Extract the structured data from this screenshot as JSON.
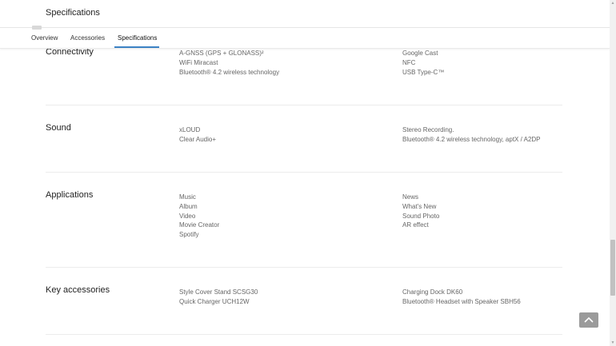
{
  "header": {
    "title": "Specifications"
  },
  "tabs": [
    {
      "label": "Overview"
    },
    {
      "label": "Accessories"
    },
    {
      "label": "Specifications",
      "active": true
    }
  ],
  "sections": [
    {
      "title": "Connectivity",
      "left": [
        "A-GNSS (GPS + GLONASS)²",
        "WiFi Miracast",
        "Bluetooth® 4.2 wireless technology"
      ],
      "right": [
        "Google Cast",
        "NFC",
        "USB Type-C™"
      ]
    },
    {
      "title": "Sound",
      "left": [
        "xLOUD",
        "Clear Audio+"
      ],
      "right": [
        "Stereo Recording.",
        "Bluetooth® 4.2 wireless technology, aptX / A2DP"
      ]
    },
    {
      "title": "Applications",
      "left": [
        "Music",
        "Album",
        "Video",
        "Movie Creator",
        "Spotify"
      ],
      "right": [
        "News",
        "What's New",
        "Sound Photo",
        "AR effect"
      ]
    },
    {
      "title": "Key accessories",
      "left": [
        "Style Cover Stand SCSG30",
        "Quick Charger UCH12W"
      ],
      "right": [
        "Charging Dock DK60",
        "Bluetooth® Headset with Speaker SBH56"
      ]
    }
  ],
  "icons": {
    "back_to_top": "chevron-up-icon",
    "scroll_up": "triangle-up-icon",
    "scroll_down": "triangle-down-icon"
  },
  "colors": {
    "accent": "#3b82c4",
    "back_to_top": "#9a9a9a"
  }
}
